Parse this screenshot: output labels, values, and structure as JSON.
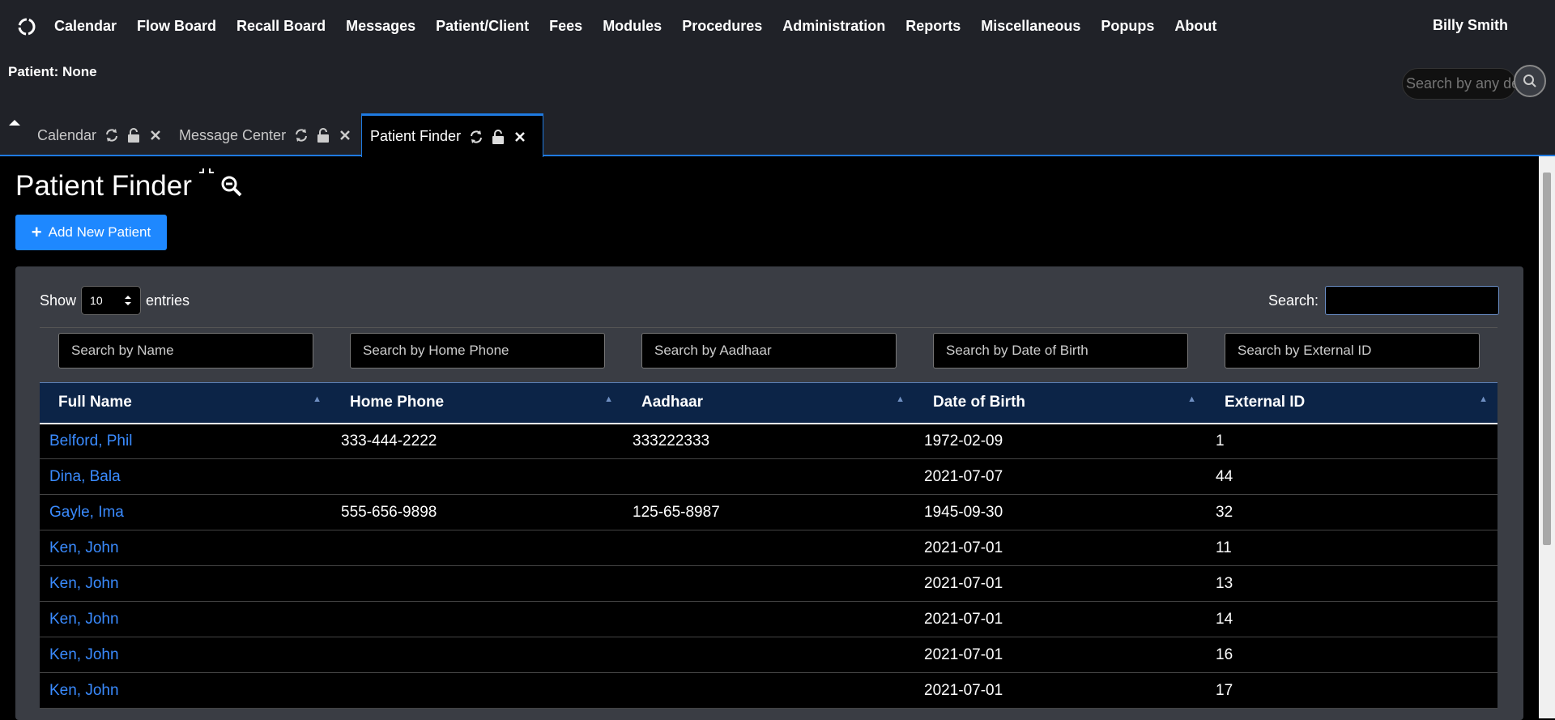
{
  "nav": {
    "items": [
      "Calendar",
      "Flow Board",
      "Recall Board",
      "Messages",
      "Patient/Client",
      "Fees",
      "Modules",
      "Procedures",
      "Administration",
      "Reports",
      "Miscellaneous",
      "Popups",
      "About"
    ],
    "user": "Billy Smith"
  },
  "patient_bar": {
    "label": "Patient: None",
    "search_placeholder": "Search by any demographics"
  },
  "tabs": [
    {
      "label": "Calendar"
    },
    {
      "label": "Message Center"
    },
    {
      "label": "Patient Finder"
    }
  ],
  "page": {
    "title": "Patient Finder",
    "add_button": "Add New Patient",
    "show_label": "Show",
    "entries_label": "entries",
    "length_value": "10",
    "search_label": "Search:",
    "search_value": ""
  },
  "filters": [
    "Search by Name",
    "Search by Home Phone",
    "Search by Aadhaar",
    "Search by Date of Birth",
    "Search by External ID"
  ],
  "table": {
    "headers": [
      "Full Name",
      "Home Phone",
      "Aadhaar",
      "Date of Birth",
      "External ID"
    ],
    "rows": [
      [
        "Belford, Phil",
        "333-444-2222",
        "333222333",
        "1972-02-09",
        "1"
      ],
      [
        "Dina, Bala",
        "",
        "",
        "2021-07-07",
        "44"
      ],
      [
        "Gayle, Ima",
        "555-656-9898",
        "125-65-8987",
        "1945-09-30",
        "32"
      ],
      [
        "Ken, John",
        "",
        "",
        "2021-07-01",
        "11"
      ],
      [
        "Ken, John",
        "",
        "",
        "2021-07-01",
        "13"
      ],
      [
        "Ken, John",
        "",
        "",
        "2021-07-01",
        "14"
      ],
      [
        "Ken, John",
        "",
        "",
        "2021-07-01",
        "16"
      ],
      [
        "Ken, John",
        "",
        "",
        "2021-07-01",
        "17"
      ]
    ]
  },
  "colors": {
    "accent": "#1e88ff",
    "link": "#3a8bff",
    "nav_bg": "#202228",
    "table_header_bg": "#0c2447"
  }
}
